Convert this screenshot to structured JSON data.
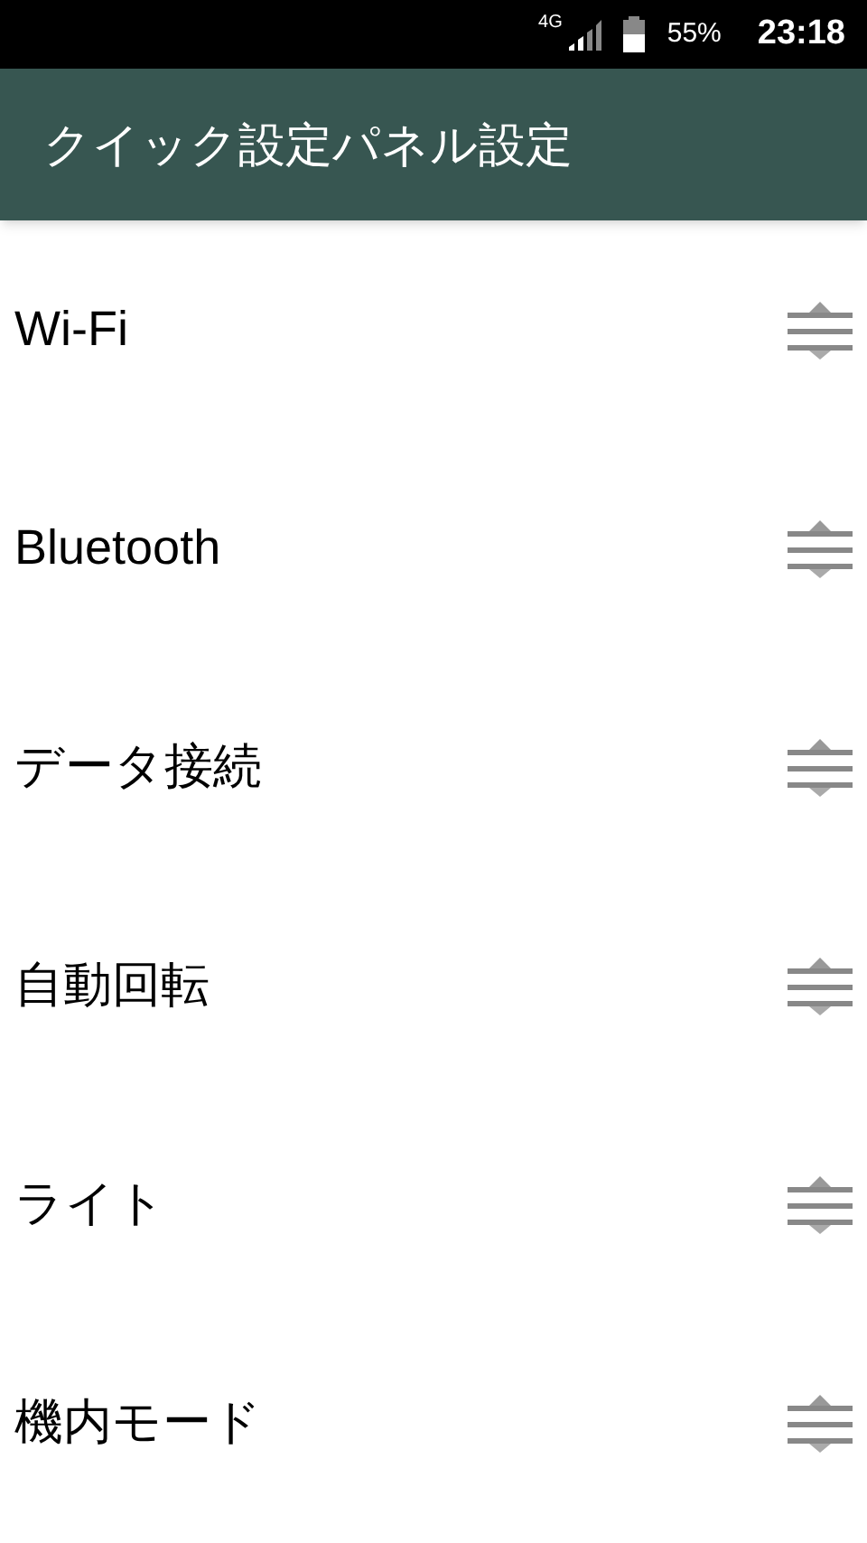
{
  "status_bar": {
    "network": "4G",
    "battery": "55%",
    "time": "23:18"
  },
  "title": "クイック設定パネル設定",
  "items": [
    {
      "label": "Wi-Fi"
    },
    {
      "label": "Bluetooth"
    },
    {
      "label": "データ接続"
    },
    {
      "label": "自動回転"
    },
    {
      "label": "ライト"
    },
    {
      "label": "機内モード"
    }
  ]
}
